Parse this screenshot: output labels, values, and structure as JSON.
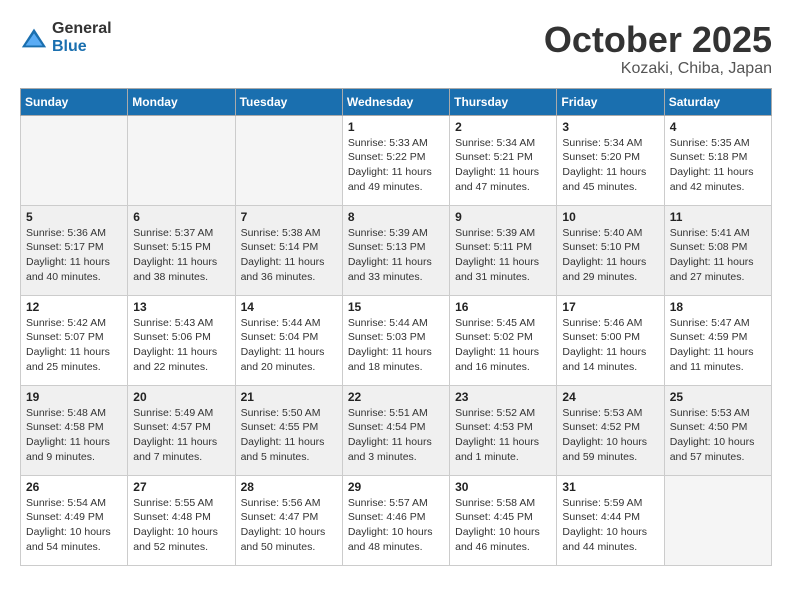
{
  "header": {
    "logo_general": "General",
    "logo_blue": "Blue",
    "month_title": "October 2025",
    "location": "Kozaki, Chiba, Japan"
  },
  "weekdays": [
    "Sunday",
    "Monday",
    "Tuesday",
    "Wednesday",
    "Thursday",
    "Friday",
    "Saturday"
  ],
  "weeks": [
    [
      {
        "day": "",
        "info": ""
      },
      {
        "day": "",
        "info": ""
      },
      {
        "day": "",
        "info": ""
      },
      {
        "day": "1",
        "info": "Sunrise: 5:33 AM\nSunset: 5:22 PM\nDaylight: 11 hours\nand 49 minutes."
      },
      {
        "day": "2",
        "info": "Sunrise: 5:34 AM\nSunset: 5:21 PM\nDaylight: 11 hours\nand 47 minutes."
      },
      {
        "day": "3",
        "info": "Sunrise: 5:34 AM\nSunset: 5:20 PM\nDaylight: 11 hours\nand 45 minutes."
      },
      {
        "day": "4",
        "info": "Sunrise: 5:35 AM\nSunset: 5:18 PM\nDaylight: 11 hours\nand 42 minutes."
      }
    ],
    [
      {
        "day": "5",
        "info": "Sunrise: 5:36 AM\nSunset: 5:17 PM\nDaylight: 11 hours\nand 40 minutes."
      },
      {
        "day": "6",
        "info": "Sunrise: 5:37 AM\nSunset: 5:15 PM\nDaylight: 11 hours\nand 38 minutes."
      },
      {
        "day": "7",
        "info": "Sunrise: 5:38 AM\nSunset: 5:14 PM\nDaylight: 11 hours\nand 36 minutes."
      },
      {
        "day": "8",
        "info": "Sunrise: 5:39 AM\nSunset: 5:13 PM\nDaylight: 11 hours\nand 33 minutes."
      },
      {
        "day": "9",
        "info": "Sunrise: 5:39 AM\nSunset: 5:11 PM\nDaylight: 11 hours\nand 31 minutes."
      },
      {
        "day": "10",
        "info": "Sunrise: 5:40 AM\nSunset: 5:10 PM\nDaylight: 11 hours\nand 29 minutes."
      },
      {
        "day": "11",
        "info": "Sunrise: 5:41 AM\nSunset: 5:08 PM\nDaylight: 11 hours\nand 27 minutes."
      }
    ],
    [
      {
        "day": "12",
        "info": "Sunrise: 5:42 AM\nSunset: 5:07 PM\nDaylight: 11 hours\nand 25 minutes."
      },
      {
        "day": "13",
        "info": "Sunrise: 5:43 AM\nSunset: 5:06 PM\nDaylight: 11 hours\nand 22 minutes."
      },
      {
        "day": "14",
        "info": "Sunrise: 5:44 AM\nSunset: 5:04 PM\nDaylight: 11 hours\nand 20 minutes."
      },
      {
        "day": "15",
        "info": "Sunrise: 5:44 AM\nSunset: 5:03 PM\nDaylight: 11 hours\nand 18 minutes."
      },
      {
        "day": "16",
        "info": "Sunrise: 5:45 AM\nSunset: 5:02 PM\nDaylight: 11 hours\nand 16 minutes."
      },
      {
        "day": "17",
        "info": "Sunrise: 5:46 AM\nSunset: 5:00 PM\nDaylight: 11 hours\nand 14 minutes."
      },
      {
        "day": "18",
        "info": "Sunrise: 5:47 AM\nSunset: 4:59 PM\nDaylight: 11 hours\nand 11 minutes."
      }
    ],
    [
      {
        "day": "19",
        "info": "Sunrise: 5:48 AM\nSunset: 4:58 PM\nDaylight: 11 hours\nand 9 minutes."
      },
      {
        "day": "20",
        "info": "Sunrise: 5:49 AM\nSunset: 4:57 PM\nDaylight: 11 hours\nand 7 minutes."
      },
      {
        "day": "21",
        "info": "Sunrise: 5:50 AM\nSunset: 4:55 PM\nDaylight: 11 hours\nand 5 minutes."
      },
      {
        "day": "22",
        "info": "Sunrise: 5:51 AM\nSunset: 4:54 PM\nDaylight: 11 hours\nand 3 minutes."
      },
      {
        "day": "23",
        "info": "Sunrise: 5:52 AM\nSunset: 4:53 PM\nDaylight: 11 hours\nand 1 minute."
      },
      {
        "day": "24",
        "info": "Sunrise: 5:53 AM\nSunset: 4:52 PM\nDaylight: 10 hours\nand 59 minutes."
      },
      {
        "day": "25",
        "info": "Sunrise: 5:53 AM\nSunset: 4:50 PM\nDaylight: 10 hours\nand 57 minutes."
      }
    ],
    [
      {
        "day": "26",
        "info": "Sunrise: 5:54 AM\nSunset: 4:49 PM\nDaylight: 10 hours\nand 54 minutes."
      },
      {
        "day": "27",
        "info": "Sunrise: 5:55 AM\nSunset: 4:48 PM\nDaylight: 10 hours\nand 52 minutes."
      },
      {
        "day": "28",
        "info": "Sunrise: 5:56 AM\nSunset: 4:47 PM\nDaylight: 10 hours\nand 50 minutes."
      },
      {
        "day": "29",
        "info": "Sunrise: 5:57 AM\nSunset: 4:46 PM\nDaylight: 10 hours\nand 48 minutes."
      },
      {
        "day": "30",
        "info": "Sunrise: 5:58 AM\nSunset: 4:45 PM\nDaylight: 10 hours\nand 46 minutes."
      },
      {
        "day": "31",
        "info": "Sunrise: 5:59 AM\nSunset: 4:44 PM\nDaylight: 10 hours\nand 44 minutes."
      },
      {
        "day": "",
        "info": ""
      }
    ]
  ]
}
